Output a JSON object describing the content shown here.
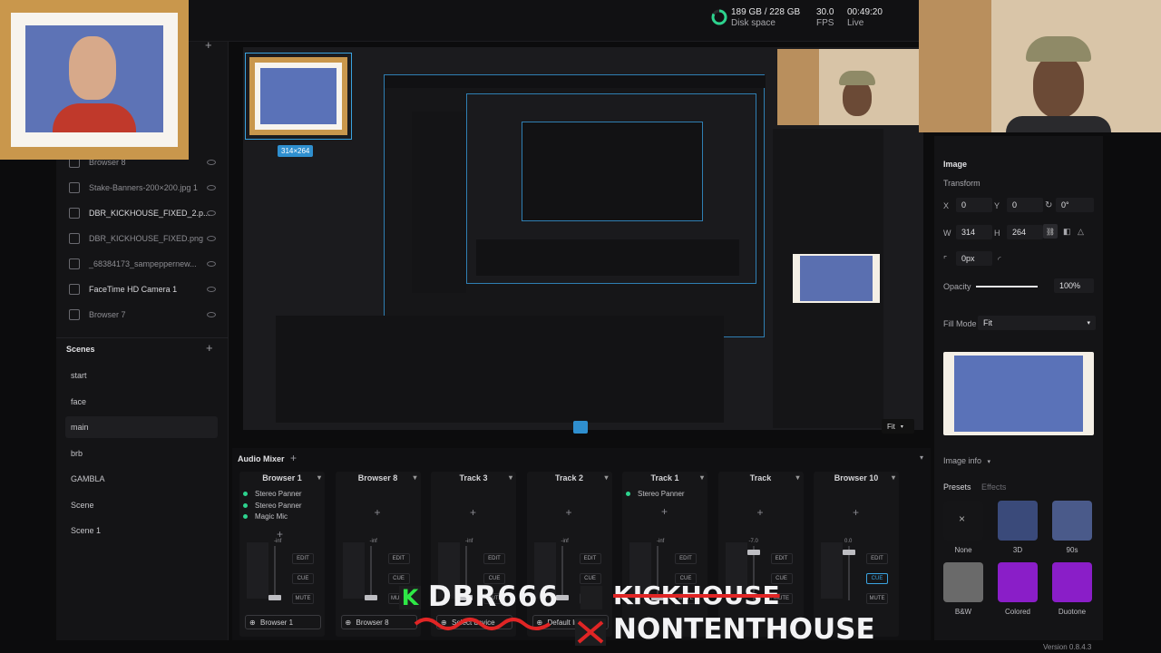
{
  "topbar": {
    "disk_value": "189 GB / 228 GB",
    "disk_label": "Disk space",
    "fps_value": "30.0",
    "fps_label": "FPS",
    "time_value": "00:49:20",
    "time_label": "Live",
    "disk_used_fraction": 0.83
  },
  "sources": {
    "items": [
      {
        "label": "Browser 8",
        "icon": "globe-icon"
      },
      {
        "label": "Stake-Banners-200×200.jpg 1",
        "icon": "image-icon"
      },
      {
        "label": "DBR_KICKHOUSE_FIXED_2.p...",
        "icon": "image-icon"
      },
      {
        "label": "DBR_KICKHOUSE_FIXED.png",
        "icon": "image-icon"
      },
      {
        "label": "_68384173_sampeppernew...",
        "icon": "image-icon"
      },
      {
        "label": "FaceTime HD Camera 1",
        "icon": "camera-icon"
      },
      {
        "label": "Browser 7",
        "icon": "globe-icon"
      }
    ]
  },
  "scenes": {
    "title": "Scenes",
    "items": [
      "start",
      "face",
      "main",
      "brb",
      "GAMBLA",
      "Scene",
      "Scene 1"
    ],
    "active": "main"
  },
  "canvas": {
    "selection_size": "314×264"
  },
  "inspector": {
    "section_title": "Image",
    "transform_label": "Transform",
    "x_label": "X",
    "x_value": "0",
    "y_label": "Y",
    "y_value": "0",
    "rotation_value": "0°",
    "w_label": "W",
    "w_value": "314",
    "h_label": "H",
    "h_value": "264",
    "radius_value": "0px",
    "opacity_label": "Opacity",
    "opacity_value": "100%",
    "opacity_fraction": 1.0,
    "fill_mode_label": "Fill Mode",
    "fill_mode_value": "Fit",
    "image_info_label": "Image info",
    "tabs": [
      "Presets",
      "Effects"
    ],
    "presets": [
      "None",
      "3D",
      "90s",
      "B&W",
      "Colored",
      "Duotone"
    ],
    "version": "Version 0.8.4.3"
  },
  "mixer": {
    "title": "Audio Mixer",
    "tracks": [
      {
        "name": "Browser 1",
        "filters": [
          "Stereo Panner",
          "Stereo Panner",
          "Magic Mic"
        ],
        "level": "-inf",
        "device": "Browser 1",
        "buttons": [
          "EDIT",
          "CUE",
          "MUTE"
        ]
      },
      {
        "name": "Browser 8",
        "filters": [],
        "level": "-inf",
        "device": "Browser 8",
        "buttons": [
          "EDIT",
          "CUE",
          "MUTE"
        ]
      },
      {
        "name": "Track 3",
        "filters": [],
        "level": "-inf",
        "device": "Select device",
        "buttons": [
          "EDIT",
          "CUE",
          "MUTE"
        ]
      },
      {
        "name": "Track 2",
        "filters": [],
        "level": "-inf",
        "device": "Default In",
        "buttons": [
          "EDIT",
          "CUE",
          "MUTE"
        ]
      },
      {
        "name": "Track 1",
        "filters": [
          "Stereo Panner"
        ],
        "level": "-inf",
        "device": "",
        "buttons": [
          "EDIT",
          "CUE",
          "MUTE"
        ]
      },
      {
        "name": "Track",
        "filters": [],
        "level": "-7.0",
        "device": "",
        "buttons": [
          "EDIT",
          "CUE",
          "MUTE"
        ]
      },
      {
        "name": "Browser 10",
        "filters": [],
        "level": "0.0",
        "device": "",
        "buttons": [
          "EDIT",
          "CUE",
          "MUTE"
        ]
      }
    ]
  },
  "overlay": {
    "k_letter": "K",
    "line1": "DBR666",
    "strike_text": "KICKHOUSE",
    "line2": "NONTENTHOUSE",
    "fit_label": "Fit"
  },
  "colors": {
    "accent": "#3aa3e0",
    "green": "#2ee846",
    "filter_dot": "#2dd38e",
    "panel": "#141416",
    "background": "#0c0c0d"
  }
}
